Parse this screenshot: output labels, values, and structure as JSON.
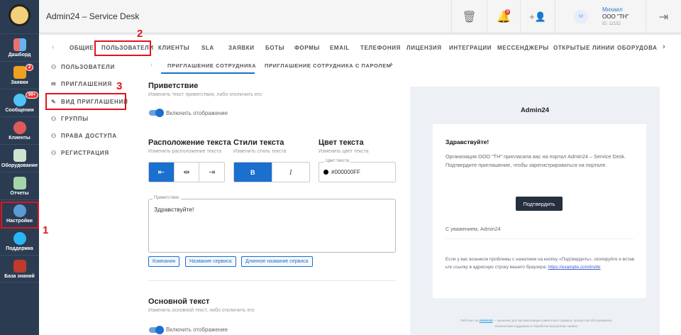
{
  "header": {
    "title": "Admin24 – Service Desk",
    "notif_count": "8",
    "user": {
      "initial": "М",
      "name": "Михаил",
      "org": "ООО \"ТН\"",
      "id": "ID: 12152"
    }
  },
  "sidebar": [
    {
      "label": "Дашборд"
    },
    {
      "label": "Заявки",
      "badge": "2"
    },
    {
      "label": "Сообщения",
      "badge": "99+"
    },
    {
      "label": "Клиенты"
    },
    {
      "label": "Оборудование"
    },
    {
      "label": "Отчеты"
    },
    {
      "label": "Настройки"
    },
    {
      "label": "Поддержка"
    },
    {
      "label": "База знаний"
    }
  ],
  "tabs": [
    "ОБЩИЕ",
    "ПОЛЬЗОВАТЕЛИ",
    "КЛИЕНТЫ",
    "SLA",
    "ЗАЯВКИ",
    "БОТЫ",
    "ФОРМЫ",
    "EMAIL",
    "ТЕЛЕФОНИЯ",
    "ЛИЦЕНЗИЯ",
    "ИНТЕГРАЦИИ",
    "МЕССЕНДЖЕРЫ",
    "ОТКРЫТЫЕ ЛИНИИ",
    "ОБОРУДОВАН"
  ],
  "submenu": [
    "ПОЛЬЗОВАТЕЛИ",
    "ПРИГЛАШЕНИЯ",
    "ВИД ПРИГЛАШЕНИЙ",
    "ГРУППЫ",
    "ПРАВА ДОСТУПА",
    "РЕГИСТРАЦИЯ"
  ],
  "subtabs": [
    "ПРИГЛАШЕНИЕ СОТРУДНИКА",
    "ПРИГЛАШЕНИЕ СОТРУДНИКА С ПАРОЛЕМ"
  ],
  "annotations": [
    "1",
    "2",
    "3"
  ],
  "form": {
    "greeting": {
      "title": "Приветствие",
      "hint": "Изменить текст приветствия, либо отключить его",
      "toggle": "Включить отображение",
      "enabled": true
    },
    "layout": {
      "title": "Расположение текста",
      "hint": "Изменить расположение текста"
    },
    "style": {
      "title": "Стили текста",
      "hint": "Изменить стиль текста",
      "bold": "B",
      "italic": "I"
    },
    "color": {
      "title": "Цвет текста",
      "hint": "Изменить цвет текста",
      "label": "Цвет текста",
      "value": "#000000FF"
    },
    "textarea": {
      "label": "Приветствие",
      "value": "Здравствуйте!"
    },
    "chips": [
      "Компания",
      "Название сервиса",
      "Длинное название сервиса"
    ],
    "main": {
      "title": "Основной текст",
      "hint": "Изменить основной текст, либо отключить его",
      "toggle": "Включить отображение",
      "enabled": true
    }
  },
  "preview": {
    "brand": "Admin24",
    "greeting": "Здравствуйте!",
    "body": "Организация ООО \"ТН\" пригласила вас на портал Admin24 – Service Desk. Подтвердите приглашение, чтобы зарегистрироваться на портале.",
    "button": "Подтвердить",
    "regards": "С уважением, Admin24",
    "help": "Если у вас возникли проблемы с нажатием на кнопку «Подтвердить», скопируйте и вставьте ссылку в адресную строку вашего браузера:",
    "link": "https://example.com/invite",
    "footer_pre": "Работает на",
    "footer_link": "Admin24",
    "footer_post": "— решение для автоматизации клиентского сервиса, процессов обслуживания, технической поддержки и обработки внутренних заявок."
  }
}
